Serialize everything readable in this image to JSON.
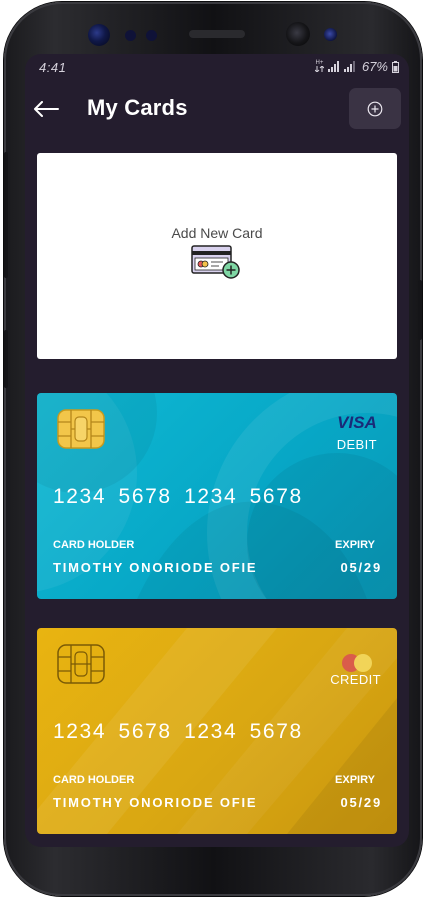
{
  "status": {
    "time": "4:41",
    "net_top": "H+",
    "battery": "67%"
  },
  "app_bar": {
    "title": "My Cards",
    "back_icon": "arrow-left-icon",
    "add_icon": "plus-circle-icon"
  },
  "add_card": {
    "label": "Add New Card",
    "icon": "card-add-icon"
  },
  "cards": [
    {
      "brand": "VISA",
      "type": "DEBIT",
      "number": "1234 5678 1234 5678",
      "holder_label": "CARD HOLDER",
      "holder_name": "TIMOTHY ONORIODE OFIE",
      "expiry_label": "EXPIRY",
      "expiry": "05/29",
      "color": "#0fb9d4"
    },
    {
      "brand": "mastercard-logo",
      "type": "CREDIT",
      "number": "1234 5678 1234 5678",
      "holder_label": "CARD HOLDER",
      "holder_name": "TIMOTHY ONORIODE OFIE",
      "expiry_label": "EXPIRY",
      "expiry": "05/29",
      "color": "#e9b411"
    }
  ],
  "theme": {
    "background": "#241d2e",
    "button_bg": "#3a3344"
  }
}
